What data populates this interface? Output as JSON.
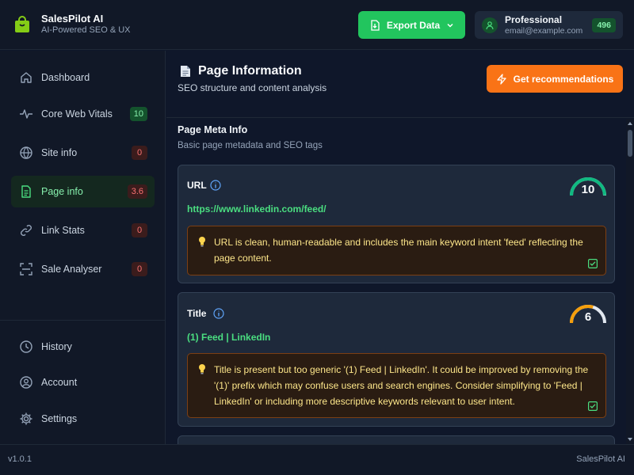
{
  "app": {
    "name": "SalesPilot AI",
    "tagline": "AI-Powered SEO & UX"
  },
  "header": {
    "export_label": "Export Data",
    "plan": "Professional",
    "email": "email@example.com",
    "credits": "496"
  },
  "sidebar": {
    "items": [
      {
        "label": "Dashboard",
        "icon": "home-icon"
      },
      {
        "label": "Core Web Vitals",
        "icon": "pulse-icon",
        "badge": "10",
        "badge_color": "#86efac"
      },
      {
        "label": "Site info",
        "icon": "globe-icon",
        "badge": "0",
        "badge_color": "#f87171"
      },
      {
        "label": "Page info",
        "icon": "document-icon",
        "badge": "3.6",
        "badge_color": "#f87171",
        "active": true
      },
      {
        "label": "Link Stats",
        "icon": "link-icon",
        "badge": "0",
        "badge_color": "#f87171"
      },
      {
        "label": "Sale Analyser",
        "icon": "scan-icon",
        "badge": "0",
        "badge_color": "#f87171"
      }
    ],
    "bottom_items": [
      {
        "label": "History",
        "icon": "clock-icon"
      },
      {
        "label": "Account",
        "icon": "user-icon"
      },
      {
        "label": "Settings",
        "icon": "gear-icon"
      }
    ]
  },
  "main": {
    "title": "Page Information",
    "subtitle": "SEO structure and content analysis",
    "recommend_label": "Get recommendations",
    "section": {
      "title": "Page Meta Info",
      "subtitle": "Basic page metadata and SEO tags"
    },
    "cards": [
      {
        "label": "URL",
        "value": "https://www.linkedin.com/feed/",
        "score": "10",
        "score_fraction": 1.0,
        "gauge_color": "#10b981",
        "note": "URL is clean, human-readable and includes the main keyword intent 'feed' reflecting the page content."
      },
      {
        "label": "Title",
        "value": "(1) Feed | LinkedIn",
        "score": "6",
        "score_fraction": 0.6,
        "gauge_color": "#f59e0b",
        "note": "Title is present but too generic '(1) Feed | LinkedIn'. It could be improved by removing the '(1)' prefix which may confuse users and search engines. Consider simplifying to 'Feed | LinkedIn' or including more descriptive keywords relevant to user intent."
      }
    ]
  },
  "footer": {
    "version": "v1.0.1",
    "brand": "SalesPilot AI"
  },
  "colors": {
    "accent_green": "#22c55e",
    "accent_orange": "#f97316",
    "background": "#0f172a"
  }
}
